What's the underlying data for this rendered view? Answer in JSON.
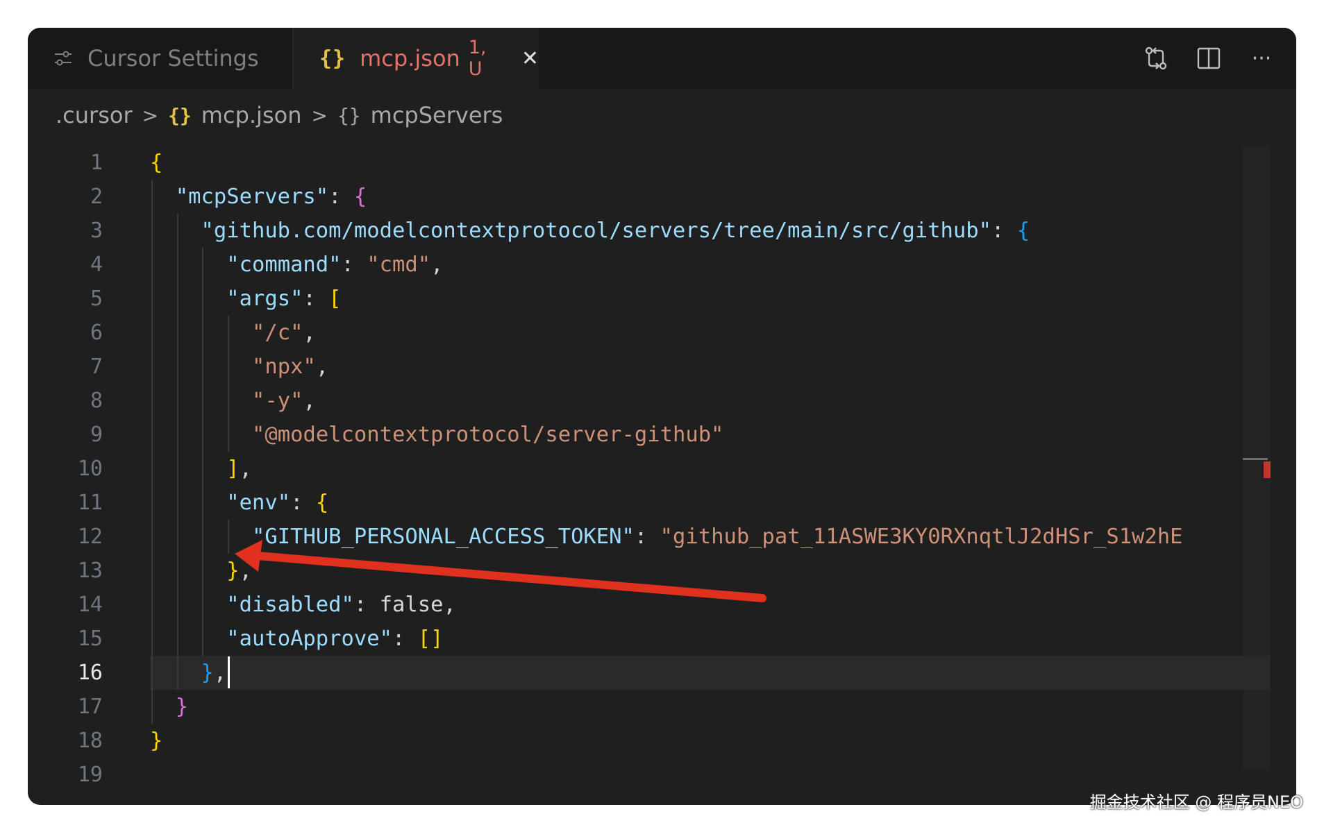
{
  "tabs": [
    {
      "label": "Cursor Settings",
      "active": false
    },
    {
      "label": "mcp.json",
      "status": "1, U",
      "active": true
    }
  ],
  "toolbar": {
    "icons": [
      "compare-icon",
      "split-editor-icon",
      "more-icon"
    ],
    "more_label": "···"
  },
  "breadcrumb": {
    "folder": ".cursor",
    "file": "mcp.json",
    "symbol": "mcpServers",
    "json_glyph": "{}",
    "obj_glyph": "{}"
  },
  "editor": {
    "current_line": 16,
    "line_numbers": [
      "1",
      "2",
      "3",
      "4",
      "5",
      "6",
      "7",
      "8",
      "9",
      "10",
      "11",
      "12",
      "13",
      "14",
      "15",
      "16",
      "17",
      "18",
      "19"
    ],
    "lines": [
      "{",
      "  \"mcpServers\": {",
      "    \"github.com/modelcontextprotocol/servers/tree/main/src/github\": {",
      "      \"command\": \"cmd\",",
      "      \"args\": [",
      "        \"/c\",",
      "        \"npx\",",
      "        \"-y\",",
      "        \"@modelcontextprotocol/server-github\"",
      "      ],",
      "      \"env\": {",
      "        \"GITHUB_PERSONAL_ACCESS_TOKEN\": \"github_pat_11ASWE3KY0RXnqtlJ2dHSr_S1w2hE",
      "      },",
      "      \"disabled\": false,",
      "      \"autoApprove\": []",
      "    },",
      "  }",
      "}",
      ""
    ]
  },
  "colors": {
    "background": "#1f1f1f",
    "arrow": "#e0311f",
    "string": "#ce9178",
    "key": "#9cdcfe"
  },
  "watermark": "掘金技术社区 @ 程序员NEO"
}
